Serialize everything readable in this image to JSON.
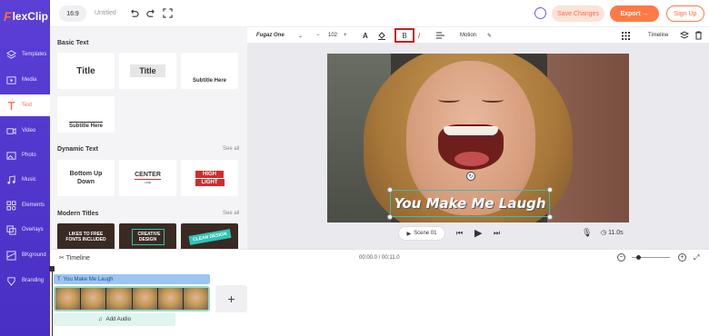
{
  "app": {
    "logo_text": "lexClip",
    "logo_letter": "F"
  },
  "nav": {
    "items": [
      {
        "label": "Templates",
        "icon": "templates-icon"
      },
      {
        "label": "Media",
        "icon": "media-icon"
      },
      {
        "label": "Text",
        "icon": "text-icon",
        "active": true
      },
      {
        "label": "Video",
        "icon": "video-icon"
      },
      {
        "label": "Photo",
        "icon": "photo-icon"
      },
      {
        "label": "Music",
        "icon": "music-icon"
      },
      {
        "label": "Elements",
        "icon": "elements-icon"
      },
      {
        "label": "Overlays",
        "icon": "overlays-icon"
      },
      {
        "label": "BKground",
        "icon": "background-icon"
      },
      {
        "label": "Branding",
        "icon": "branding-icon"
      }
    ]
  },
  "topbar": {
    "ratio": "16:9",
    "project_name": "Untitled",
    "save_label": "Save Changes",
    "export_label": "Export →",
    "signup_label": "Sign Up"
  },
  "panel": {
    "basic_text": {
      "title": "Basic Text",
      "cards": [
        "Title",
        "Title",
        "Subtitle Here",
        "Subtitle Here"
      ]
    },
    "dynamic_text": {
      "title": "Dynamic Text",
      "see_all": "See all",
      "cards": [
        "Bottom Up Down",
        "CENTER",
        "LINE",
        "HIGH",
        "LIGHT"
      ]
    },
    "modern_titles": {
      "title": "Modern Titles",
      "see_all": "See all",
      "cards": [
        "LIKES TO FREE FONTS INCLUDED",
        "CREATIVE DESIGN",
        "CLEAN DESIGN"
      ]
    }
  },
  "toolbar": {
    "font": "Fugaz One",
    "font_size": "102",
    "minus": "−",
    "plus": "+",
    "bold": "B",
    "italic": "/",
    "motion": "Motion",
    "timeline_label": "Timeline"
  },
  "canvas": {
    "caption": "You Make Me Laugh"
  },
  "playback": {
    "scene_label": "Scene  01",
    "duration": "11.0s"
  },
  "timeline": {
    "label": "Timeline",
    "time": "00:00.0 / 00:11.0",
    "text_clip": "You Make Me Laugh",
    "add_audio": "Add Audio",
    "add_scene": "+"
  },
  "colors": {
    "nav_bg": "#5b3fd6",
    "accent": "#ff7a45",
    "highlight_box": "#c91f1f",
    "selection": "#2ec4b6"
  }
}
